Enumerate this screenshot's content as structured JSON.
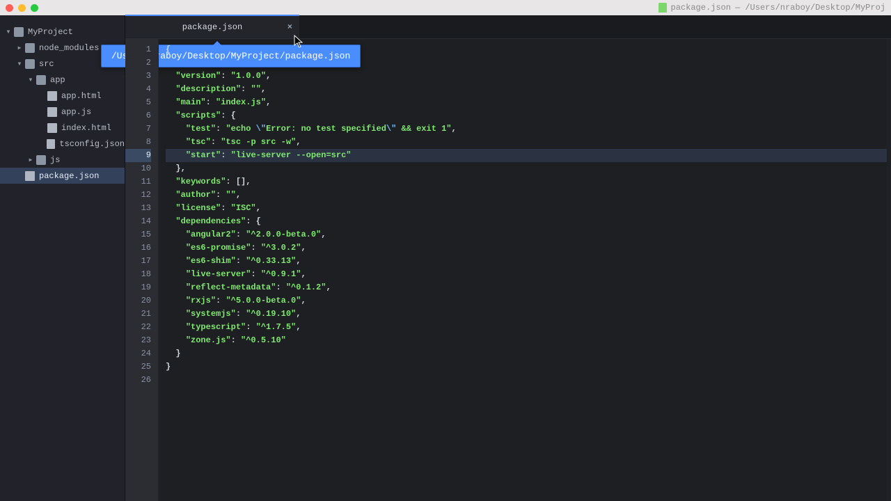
{
  "window": {
    "title_file": "package.json",
    "title_path": "— /Users/nraboy/Desktop/MyProj"
  },
  "tree": {
    "root": "MyProject",
    "items": [
      {
        "label": "node_modules",
        "kind": "folder",
        "depth": 1,
        "chev": "▸"
      },
      {
        "label": "src",
        "kind": "folder",
        "depth": 1,
        "chev": "▾"
      },
      {
        "label": "app",
        "kind": "folder",
        "depth": 2,
        "chev": "▾"
      },
      {
        "label": "app.html",
        "kind": "file",
        "depth": 3
      },
      {
        "label": "app.js",
        "kind": "file",
        "depth": 3
      },
      {
        "label": "index.html",
        "kind": "file",
        "depth": 3
      },
      {
        "label": "tsconfig.json",
        "kind": "file",
        "depth": 3
      },
      {
        "label": "js",
        "kind": "folder",
        "depth": 2,
        "chev": "▸"
      },
      {
        "label": "package.json",
        "kind": "file",
        "depth": 1,
        "selected": true
      }
    ]
  },
  "tab": {
    "label": "package.json",
    "close": "×",
    "tooltip": "/Users/nraboy/Desktop/MyProject/package.json"
  },
  "highlight_line": 9,
  "total_gutter_lines": 26,
  "code_lines": [
    [
      [
        "brace",
        "{"
      ]
    ],
    [
      [
        "brace",
        "  "
      ]
    ],
    [
      [
        "punct",
        "  "
      ],
      [
        "key",
        "\"version\""
      ],
      [
        "punct",
        ": "
      ],
      [
        "str",
        "\"1.0.0\""
      ],
      [
        "punct",
        ","
      ]
    ],
    [
      [
        "punct",
        "  "
      ],
      [
        "key",
        "\"description\""
      ],
      [
        "punct",
        ": "
      ],
      [
        "str",
        "\"\""
      ],
      [
        "punct",
        ","
      ]
    ],
    [
      [
        "punct",
        "  "
      ],
      [
        "key",
        "\"main\""
      ],
      [
        "punct",
        ": "
      ],
      [
        "str",
        "\"index.js\""
      ],
      [
        "punct",
        ","
      ]
    ],
    [
      [
        "punct",
        "  "
      ],
      [
        "key",
        "\"scripts\""
      ],
      [
        "punct",
        ": "
      ],
      [
        "brace",
        "{"
      ]
    ],
    [
      [
        "punct",
        "    "
      ],
      [
        "key",
        "\"test\""
      ],
      [
        "punct",
        ": "
      ],
      [
        "str",
        "\"echo "
      ],
      [
        "esc",
        "\\\""
      ],
      [
        "str",
        "Error: no test specified"
      ],
      [
        "esc",
        "\\\""
      ],
      [
        "str",
        " && exit 1\""
      ],
      [
        "punct",
        ","
      ]
    ],
    [
      [
        "punct",
        "    "
      ],
      [
        "key",
        "\"tsc\""
      ],
      [
        "punct",
        ": "
      ],
      [
        "str",
        "\"tsc -p src -w\""
      ],
      [
        "punct",
        ","
      ]
    ],
    [
      [
        "punct",
        "    "
      ],
      [
        "key",
        "\"start\""
      ],
      [
        "punct",
        ": "
      ],
      [
        "str",
        "\"live-server --open=src\""
      ]
    ],
    [
      [
        "punct",
        "  "
      ],
      [
        "brace",
        "},"
      ]
    ],
    [
      [
        "punct",
        "  "
      ],
      [
        "key",
        "\"keywords\""
      ],
      [
        "punct",
        ": "
      ],
      [
        "brace",
        "[]"
      ],
      [
        "punct",
        ","
      ]
    ],
    [
      [
        "punct",
        "  "
      ],
      [
        "key",
        "\"author\""
      ],
      [
        "punct",
        ": "
      ],
      [
        "str",
        "\"\""
      ],
      [
        "punct",
        ","
      ]
    ],
    [
      [
        "punct",
        "  "
      ],
      [
        "key",
        "\"license\""
      ],
      [
        "punct",
        ": "
      ],
      [
        "str",
        "\"ISC\""
      ],
      [
        "punct",
        ","
      ]
    ],
    [
      [
        "punct",
        "  "
      ],
      [
        "key",
        "\"dependencies\""
      ],
      [
        "punct",
        ": "
      ],
      [
        "brace",
        "{"
      ]
    ],
    [
      [
        "punct",
        "    "
      ],
      [
        "key",
        "\"angular2\""
      ],
      [
        "punct",
        ": "
      ],
      [
        "str",
        "\"^2.0.0-beta.0\""
      ],
      [
        "punct",
        ","
      ]
    ],
    [
      [
        "punct",
        "    "
      ],
      [
        "key",
        "\"es6-promise\""
      ],
      [
        "punct",
        ": "
      ],
      [
        "str",
        "\"^3.0.2\""
      ],
      [
        "punct",
        ","
      ]
    ],
    [
      [
        "punct",
        "    "
      ],
      [
        "key",
        "\"es6-shim\""
      ],
      [
        "punct",
        ": "
      ],
      [
        "str",
        "\"^0.33.13\""
      ],
      [
        "punct",
        ","
      ]
    ],
    [
      [
        "punct",
        "    "
      ],
      [
        "key",
        "\"live-server\""
      ],
      [
        "punct",
        ": "
      ],
      [
        "str",
        "\"^0.9.1\""
      ],
      [
        "punct",
        ","
      ]
    ],
    [
      [
        "punct",
        "    "
      ],
      [
        "key",
        "\"reflect-metadata\""
      ],
      [
        "punct",
        ": "
      ],
      [
        "str",
        "\"^0.1.2\""
      ],
      [
        "punct",
        ","
      ]
    ],
    [
      [
        "punct",
        "    "
      ],
      [
        "key",
        "\"rxjs\""
      ],
      [
        "punct",
        ": "
      ],
      [
        "str",
        "\"^5.0.0-beta.0\""
      ],
      [
        "punct",
        ","
      ]
    ],
    [
      [
        "punct",
        "    "
      ],
      [
        "key",
        "\"systemjs\""
      ],
      [
        "punct",
        ": "
      ],
      [
        "str",
        "\"^0.19.10\""
      ],
      [
        "punct",
        ","
      ]
    ],
    [
      [
        "punct",
        "    "
      ],
      [
        "key",
        "\"typescript\""
      ],
      [
        "punct",
        ": "
      ],
      [
        "str",
        "\"^1.7.5\""
      ],
      [
        "punct",
        ","
      ]
    ],
    [
      [
        "punct",
        "    "
      ],
      [
        "key",
        "\"zone.js\""
      ],
      [
        "punct",
        ": "
      ],
      [
        "str",
        "\"^0.5.10\""
      ]
    ],
    [
      [
        "punct",
        "  "
      ],
      [
        "brace",
        "}"
      ]
    ],
    [
      [
        "brace",
        "}"
      ]
    ]
  ]
}
